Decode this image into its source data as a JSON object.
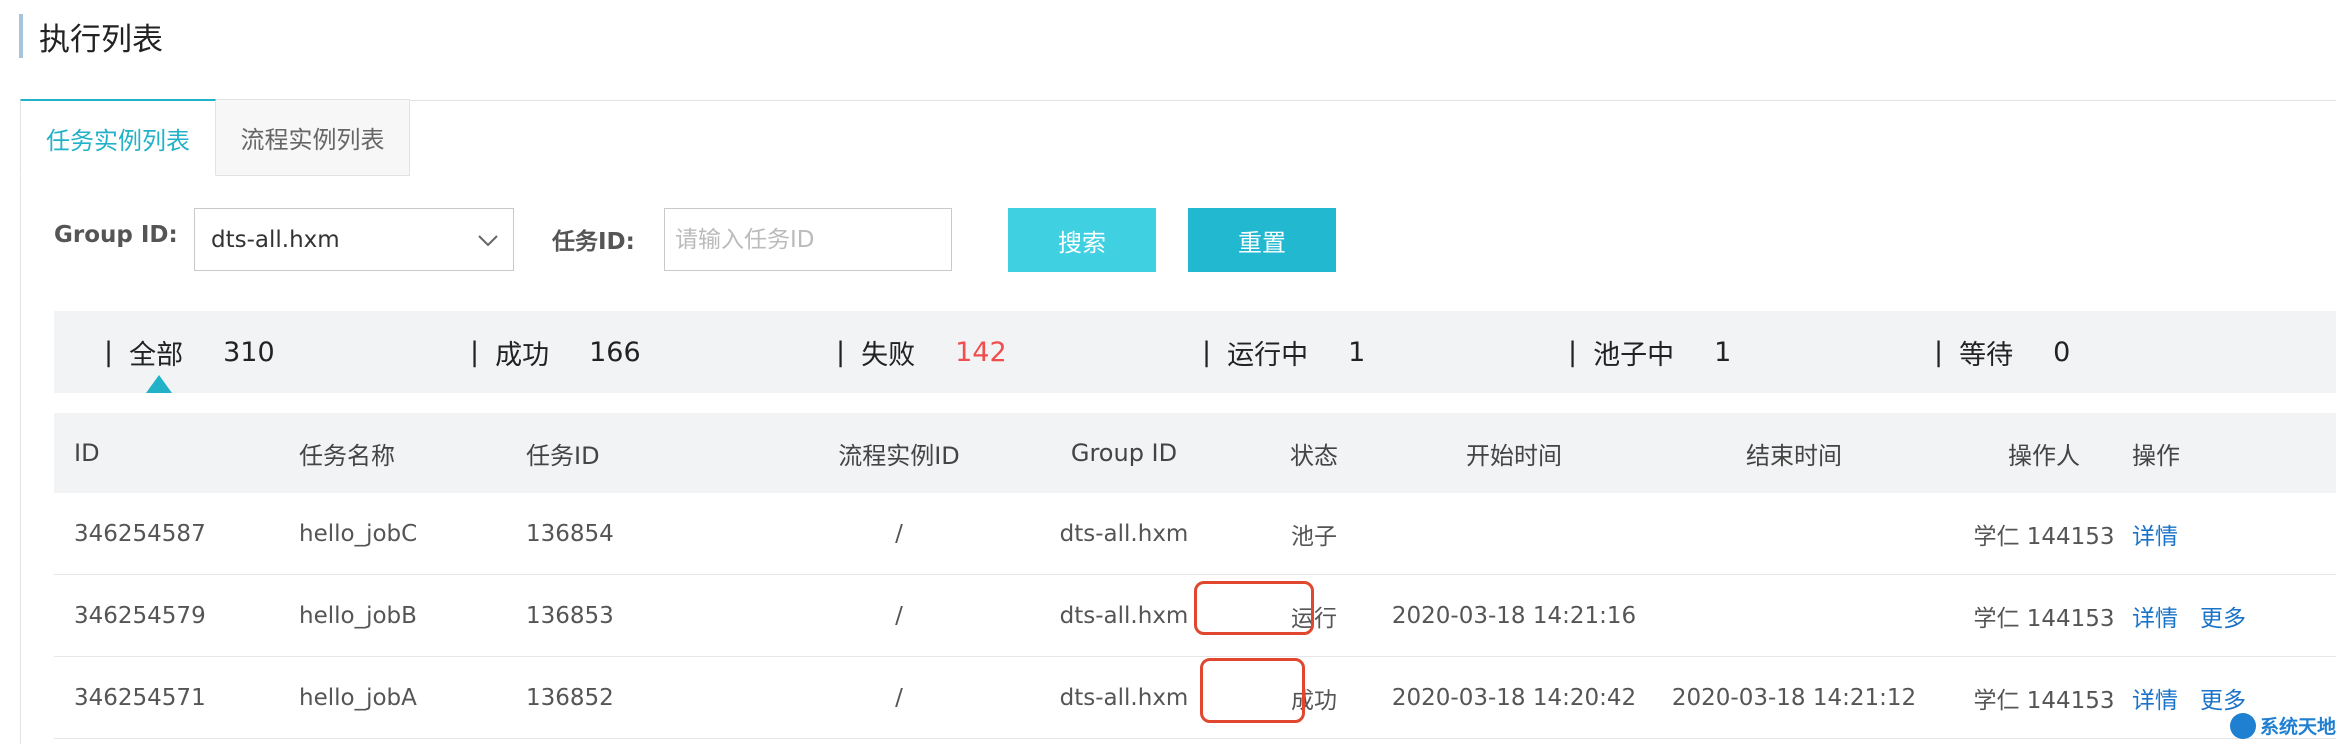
{
  "page": {
    "title": "执行列表"
  },
  "tabs": [
    {
      "label": "任务实例列表",
      "active": true
    },
    {
      "label": "流程实例列表",
      "active": false
    }
  ],
  "filters": {
    "group_label": "Group ID:",
    "group_value": "dts-all.hxm",
    "task_label": "任务ID:",
    "task_placeholder": "请输入任务ID",
    "search_label": "搜索",
    "reset_label": "重置"
  },
  "stats": [
    {
      "sep": "|",
      "label": "全部",
      "count": "310"
    },
    {
      "sep": "|",
      "label": "成功",
      "count": "166"
    },
    {
      "sep": "|",
      "label": "失败",
      "count": "142"
    },
    {
      "sep": "|",
      "label": "运行中",
      "count": "1"
    },
    {
      "sep": "|",
      "label": "池子中",
      "count": "1"
    },
    {
      "sep": "|",
      "label": "等待",
      "count": "0"
    }
  ],
  "table": {
    "headers": [
      "ID",
      "任务名称",
      "任务ID",
      "流程实例ID",
      "Group ID",
      "状态",
      "开始时间",
      "结束时间",
      "操作人",
      "操作"
    ],
    "rows": [
      {
        "id": "346254587",
        "name": "hello_jobC",
        "task_id": "136854",
        "flow_id": "/",
        "group": "dts-all.hxm",
        "status": "池子",
        "start": "",
        "end": "",
        "operator": "学仁 144153",
        "detail": "详情",
        "more": ""
      },
      {
        "id": "346254579",
        "name": "hello_jobB",
        "task_id": "136853",
        "flow_id": "/",
        "group": "dts-all.hxm",
        "status": "运行",
        "start": "2020-03-18 14:21:16",
        "end": "",
        "operator": "学仁 144153",
        "detail": "详情",
        "more": "更多"
      },
      {
        "id": "346254571",
        "name": "hello_jobA",
        "task_id": "136852",
        "flow_id": "/",
        "group": "dts-all.hxm",
        "status": "成功",
        "start": "2020-03-18 14:20:42",
        "end": "2020-03-18 14:21:12",
        "operator": "学仁 144153",
        "detail": "详情",
        "more": "更多"
      }
    ]
  },
  "watermark": {
    "text": "系统天地"
  },
  "colors": {
    "accent": "#22b2c8",
    "fail": "#f04e4e",
    "link": "#1a73c8",
    "highlight": "#e0472e"
  }
}
